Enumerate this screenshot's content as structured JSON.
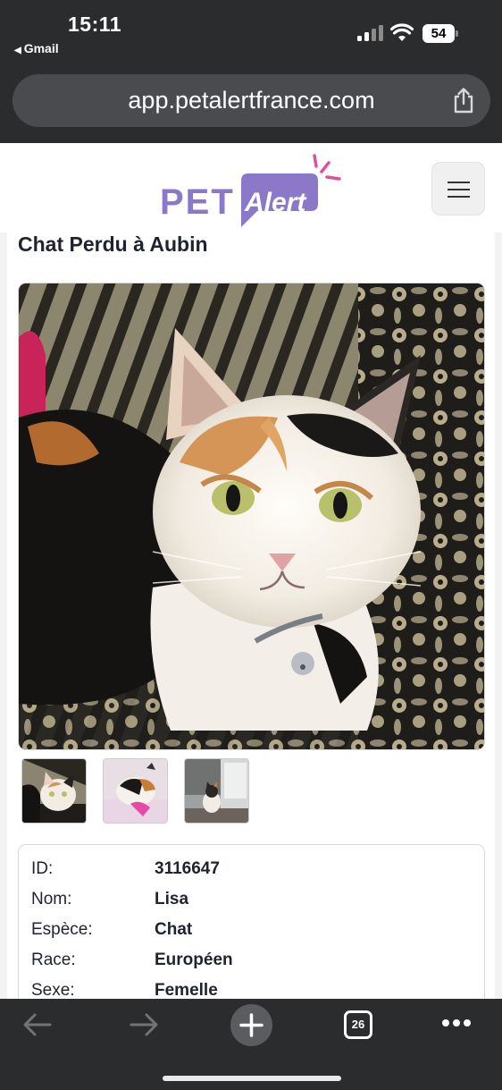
{
  "status_bar": {
    "time": "15:11",
    "back_app": "Gmail",
    "battery": "54"
  },
  "browser": {
    "url": "app.petalertfrance.com",
    "tab_count": "26"
  },
  "site": {
    "logo_pet": "PET",
    "logo_alert": "Alert",
    "brand_color": "#8b78c9",
    "accent_color": "#e24fa0"
  },
  "listing": {
    "title": "Chat Perdu à Aubin",
    "details": [
      {
        "label": "ID:",
        "value": "3116647"
      },
      {
        "label": "Nom:",
        "value": "Lisa"
      },
      {
        "label": "Espèce:",
        "value": "Chat"
      },
      {
        "label": "Race:",
        "value": "Européen"
      },
      {
        "label": "Sexe:",
        "value": "Femelle"
      }
    ]
  }
}
